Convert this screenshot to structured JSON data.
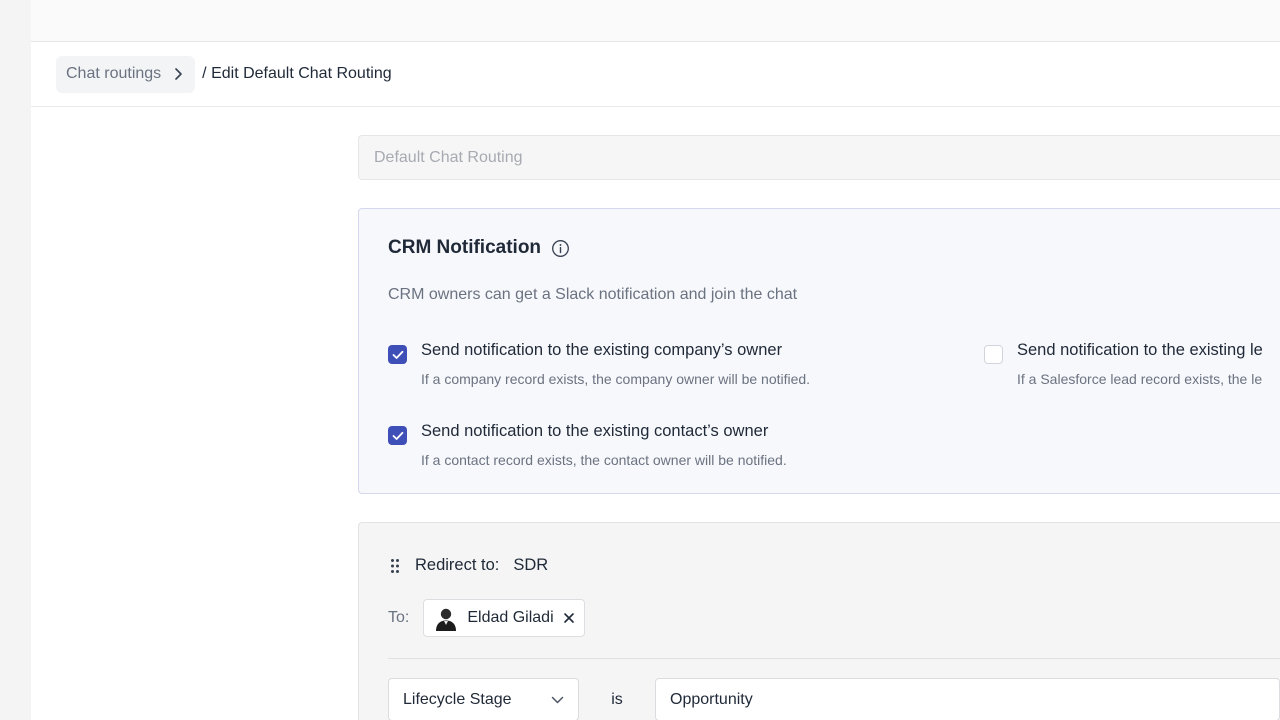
{
  "breadcrumb": {
    "parent_label": "Chat routings",
    "current_label": "/ Edit Default Chat Routing"
  },
  "routing_name": {
    "placeholder": "Default Chat Routing"
  },
  "crm_notification": {
    "title": "CRM Notification",
    "description": "CRM owners can get a Slack notification and join the chat",
    "options": [
      {
        "label": "Send notification to the existing company’s owner",
        "help": "If a company record exists, the company owner will be notified.",
        "checked": true
      },
      {
        "label": "Send notification to the existing contact’s owner",
        "help": "If a contact record exists, the contact owner will be notified.",
        "checked": true
      },
      {
        "label": "Send notification to the existing le",
        "help": "If a Salesforce lead record exists, the le",
        "checked": false
      }
    ]
  },
  "routing_rule": {
    "redirect_label": "Redirect to:",
    "redirect_value": "SDR",
    "to_label": "To:",
    "assignee": "Eldad Giladi",
    "condition": {
      "field": "Lifecycle Stage",
      "operator": "is",
      "value": "Opportunity"
    }
  },
  "colors": {
    "accent": "#3f4fb8",
    "card_border": "#d4d7ee",
    "card_bg": "#f7f8fc"
  }
}
